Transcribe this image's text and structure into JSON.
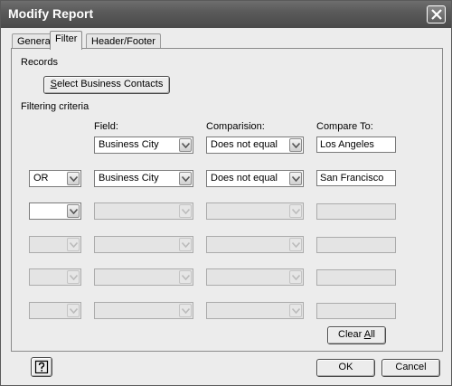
{
  "window": {
    "title": "Modify Report"
  },
  "tabs": [
    {
      "label": "General"
    },
    {
      "label": "Filter"
    },
    {
      "label": "Header/Footer"
    }
  ],
  "records": {
    "heading": "Records",
    "select_button": {
      "mnemonic": "S",
      "rest": "elect Business Contacts"
    }
  },
  "filtering": {
    "heading": "Filtering criteria",
    "columns": {
      "field": "Field:",
      "comparison": "Comparision:",
      "compare_to": "Compare To:"
    },
    "rows": [
      {
        "logic": "",
        "field": "Business City",
        "comparison": "Does not equal",
        "value": "Los Angeles",
        "enabled": true
      },
      {
        "logic": "OR",
        "field": "Business City",
        "comparison": "Does not equal",
        "value": "San Francisco",
        "enabled": true
      },
      {
        "logic": "",
        "field": "",
        "comparison": "",
        "value": "",
        "enabled": false,
        "logic_enabled": true
      },
      {
        "logic": "",
        "field": "",
        "comparison": "",
        "value": "",
        "enabled": false
      },
      {
        "logic": "",
        "field": "",
        "comparison": "",
        "value": "",
        "enabled": false
      },
      {
        "logic": "",
        "field": "",
        "comparison": "",
        "value": "",
        "enabled": false
      }
    ]
  },
  "clear_all": {
    "prefix": "Clear ",
    "mnemonic": "A",
    "rest": "ll"
  },
  "footer": {
    "ok_label": "OK",
    "cancel_label": "Cancel",
    "help_icon": "help-icon"
  }
}
